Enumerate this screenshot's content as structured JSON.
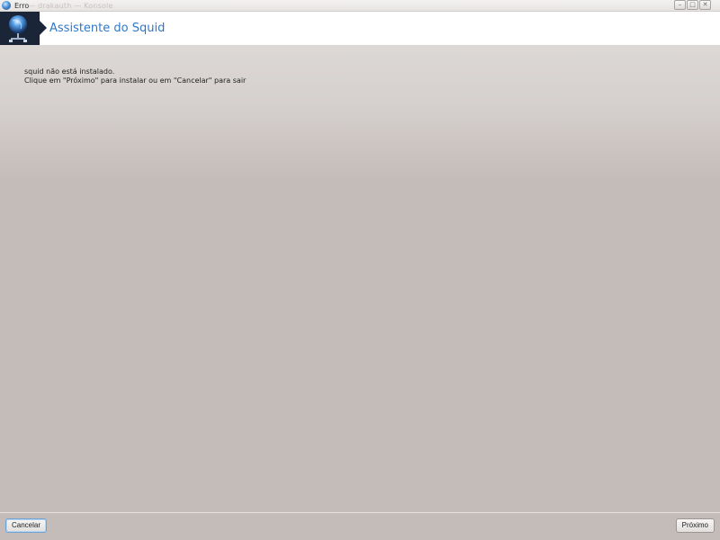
{
  "window": {
    "title": "Erro",
    "subtitle": "— drakauth — Konsole"
  },
  "header": {
    "title": "Assistente do Squid"
  },
  "message": {
    "line1": "squid não está instalado.",
    "line2": "Clique em \"Próximo\" para instalar ou em \"Cancelar\" para sair"
  },
  "footer": {
    "cancel_label": "Cancelar",
    "next_label": "Próximo"
  }
}
